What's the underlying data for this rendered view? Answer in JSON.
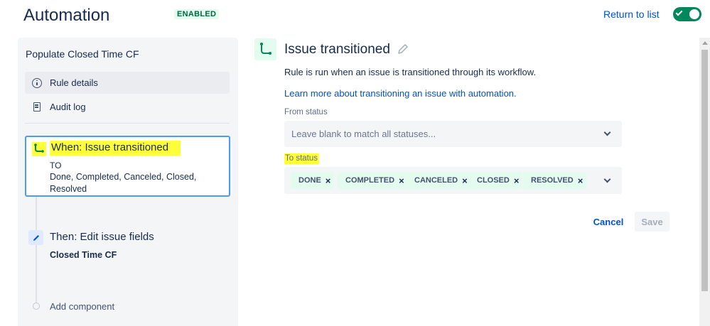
{
  "header": {
    "title": "Automation",
    "status_badge": "ENABLED",
    "return_link": "Return to list",
    "toggle_on": true
  },
  "sidebar": {
    "rule_name": "Populate Closed Time CF",
    "nav": [
      {
        "label": "Rule details",
        "icon": "info-icon"
      },
      {
        "label": "Audit log",
        "icon": "audit-log-icon"
      }
    ],
    "trigger": {
      "title": "When: Issue transitioned",
      "to_label": "TO",
      "to_values": "Done, Completed, Canceled, Closed, Resolved",
      "icon": "transition-icon"
    },
    "action": {
      "title": "Then: Edit issue fields",
      "field": "Closed Time CF",
      "icon": "pencil-icon"
    },
    "add_component": "Add component"
  },
  "detail": {
    "title": "Issue transitioned",
    "description": "Rule is run when an issue is transitioned through its workflow.",
    "learn_link": "Learn more about transitioning an issue with automation.",
    "from_status": {
      "label": "From status",
      "placeholder": "Leave blank to match all statuses..."
    },
    "to_status": {
      "label": "To status",
      "tags": [
        "DONE",
        "COMPLETED",
        "CANCELED",
        "CLOSED",
        "RESOLVED"
      ]
    },
    "cancel": "Cancel",
    "save": "Save"
  },
  "colors": {
    "accent_green": "#00875a",
    "link_blue": "#0052cc",
    "highlight": "#ffff3a",
    "tag_bg": "#e3fcef"
  }
}
